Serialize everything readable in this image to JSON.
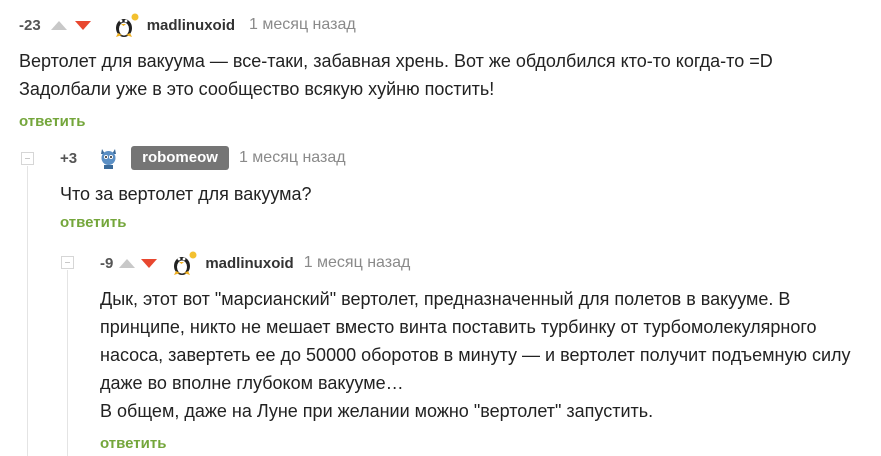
{
  "comments": [
    {
      "rating": "-23",
      "author": "madlinuxoid",
      "time": "1 месяц назад",
      "lines": [
        "Вертолет для вакуума — все-таки, забавная хрень. Вот же обдолбился кто-то когда-то =D",
        "Задолбали уже в это сообщество всякую хуйню постить!"
      ],
      "reply": "ответить",
      "avatar_icon": "penguin-avatar-icon",
      "online_dot_color": "#f3c02f"
    },
    {
      "rating": "+3",
      "author": "robomeow",
      "time": "1 месяц назад",
      "lines": [
        "Что за вертолет для вакуума?"
      ],
      "reply": "ответить",
      "avatar_icon": "robot-cat-avatar-icon"
    },
    {
      "rating": "-9",
      "author": "madlinuxoid",
      "time": "1 месяц назад",
      "lines": [
        "Дык, этот вот \"марсианский\" вертолет, предназначенный для полетов в вакууме. В",
        "принципе, никто не мешает вместо винта поставить турбинку от турбомолекулярного",
        "насоса, завертеть ее до 50000 оборотов в минуту — и вертолет получит подъемную силу",
        "даже во вполне глубоком вакууме…",
        "В общем, даже на Луне при желании можно \"вертолет\" запустить."
      ],
      "reply": "ответить",
      "avatar_icon": "penguin-avatar-icon",
      "online_dot_color": "#f3c02f"
    }
  ],
  "colors": {
    "reply_green": "#74a63b",
    "downvote_red": "#e8472f",
    "upvote_gray": "#c8c8c8",
    "author_badge_bg": "#757575"
  }
}
